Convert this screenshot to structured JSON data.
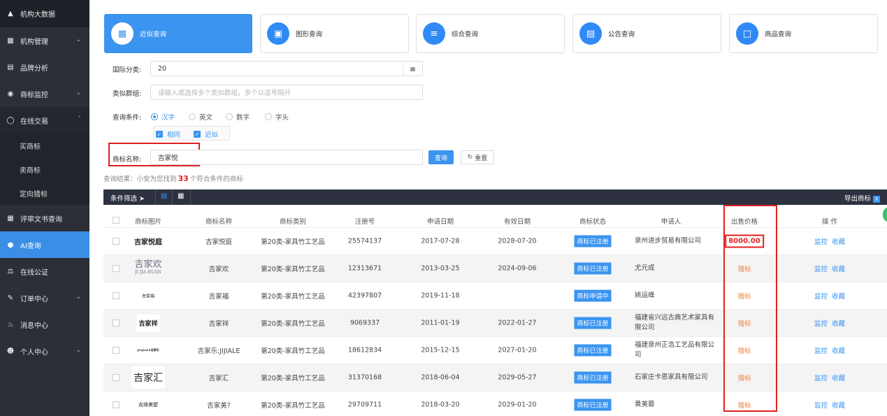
{
  "sidebar": {
    "items": [
      {
        "label": "机构大数据",
        "icon": "home-icon"
      },
      {
        "label": "机构管理",
        "icon": "bar-chart-icon"
      },
      {
        "label": "品牌分析",
        "icon": "monitor-icon"
      },
      {
        "label": "商标监控",
        "icon": "target-icon"
      },
      {
        "label": "在线交易",
        "icon": "coin-icon"
      },
      {
        "label": "买商标"
      },
      {
        "label": "卖商标"
      },
      {
        "label": "定向猎标"
      },
      {
        "label": "评审文书查询",
        "icon": "document-icon"
      },
      {
        "label": "AI查询",
        "icon": "ai-icon"
      },
      {
        "label": "在线公证",
        "icon": "notary-icon"
      },
      {
        "label": "订单中心",
        "icon": "order-icon"
      },
      {
        "label": "消息中心",
        "icon": "bell-icon"
      },
      {
        "label": "个人中心",
        "icon": "user-icon"
      }
    ]
  },
  "cards": [
    {
      "label": "近似查询",
      "icon": "similar-search-icon"
    },
    {
      "label": "图形查询",
      "icon": "image-search-icon"
    },
    {
      "label": "综合查询",
      "icon": "list-search-icon"
    },
    {
      "label": "公告查询",
      "icon": "announcement-icon"
    },
    {
      "label": "商品查询",
      "icon": "box-icon"
    }
  ],
  "form": {
    "intl_class_label": "国际分类:",
    "intl_class_value": "20",
    "group_label": "类似群组:",
    "group_placeholder": "请输入或选择多个类似群组，多个以逗号隔开",
    "condition_label": "查询条件:",
    "conditions": [
      "汉字",
      "英文",
      "数字",
      "字头"
    ],
    "match_options": [
      "相同",
      "近似"
    ],
    "name_label": "商标名称:",
    "name_value": "吉家悦",
    "search_button": "查询",
    "reset_button": "重置"
  },
  "result": {
    "prefix": "查询结果：小安为您找到",
    "count": "33",
    "suffix": "个符合条件的商标"
  },
  "toolbar": {
    "filter_label": "条件筛选",
    "export_label": "导出商标"
  },
  "table": {
    "headers": [
      "商标图片",
      "商标名称",
      "商标类别",
      "注册号",
      "申请日期",
      "有效日期",
      "商标状态",
      "申请人",
      "出售价格",
      "操 作"
    ],
    "rows": [
      {
        "image_text": "吉家悦庭",
        "name": "吉家悦庭",
        "category": "第20类-家具竹工艺品",
        "reg_no": "25574137",
        "apply_date": "2017-07-28",
        "valid_date": "2028-07-20",
        "status": "商标已注册",
        "applicant": "泉州进步贸易有限公司",
        "price": "8000.00",
        "op1": "监控",
        "op2": "收藏"
      },
      {
        "image_text": "吉家欢",
        "image_sub": "JI JIA HUAN",
        "name": "吉家欢",
        "category": "第20类-家具竹工艺品",
        "reg_no": "12313671",
        "apply_date": "2013-03-25",
        "valid_date": "2024-09-06",
        "status": "商标已注册",
        "applicant": "尤元成",
        "price": "猎标",
        "op1": "监控",
        "op2": "收藏"
      },
      {
        "image_text": "吉家福",
        "name": "吉家福",
        "category": "第20类-家具竹工艺品",
        "reg_no": "42397807",
        "apply_date": "2019-11-18",
        "valid_date": "",
        "status": "商标申请中",
        "applicant": "姚运峰",
        "price": "猎标",
        "op1": "监控",
        "op2": "收藏"
      },
      {
        "image_text": "吉家祥",
        "name": "吉家祥",
        "category": "第20类-家具竹工艺品",
        "reg_no": "9069337",
        "apply_date": "2011-01-19",
        "valid_date": "2022-01-27",
        "status": "商标已注册",
        "applicant": "福建省兴远古典艺术家具有限公司",
        "price": "猎标",
        "op1": "监控",
        "op2": "收藏"
      },
      {
        "image_text": "JIAJIALE吉家乐",
        "name": "吉家乐;JIJIALE",
        "category": "第20类-家具竹工艺品",
        "reg_no": "18612834",
        "apply_date": "2015-12-15",
        "valid_date": "2027-01-20",
        "status": "商标已注册",
        "applicant": "福建泉州正浩工艺品有限公司",
        "price": "猎标",
        "op1": "监控",
        "op2": "收藏"
      },
      {
        "image_text": "吉家汇",
        "name": "吉家汇",
        "category": "第20类-家具竹工艺品",
        "reg_no": "31370168",
        "apply_date": "2018-06-04",
        "valid_date": "2029-05-27",
        "status": "商标已注册",
        "applicant": "石家庄卡恩家具有限公司",
        "price": "猎标",
        "op1": "监控",
        "op2": "收藏"
      },
      {
        "image_text": "吉缘美墅",
        "name": "吉家美?",
        "category": "第20类-家具竹工艺品",
        "reg_no": "29709711",
        "apply_date": "2018-03-20",
        "valid_date": "2029-01-20",
        "status": "商标已注册",
        "applicant": "黄美蓉",
        "price": "猎标",
        "op1": "监控",
        "op2": "收藏"
      }
    ]
  }
}
